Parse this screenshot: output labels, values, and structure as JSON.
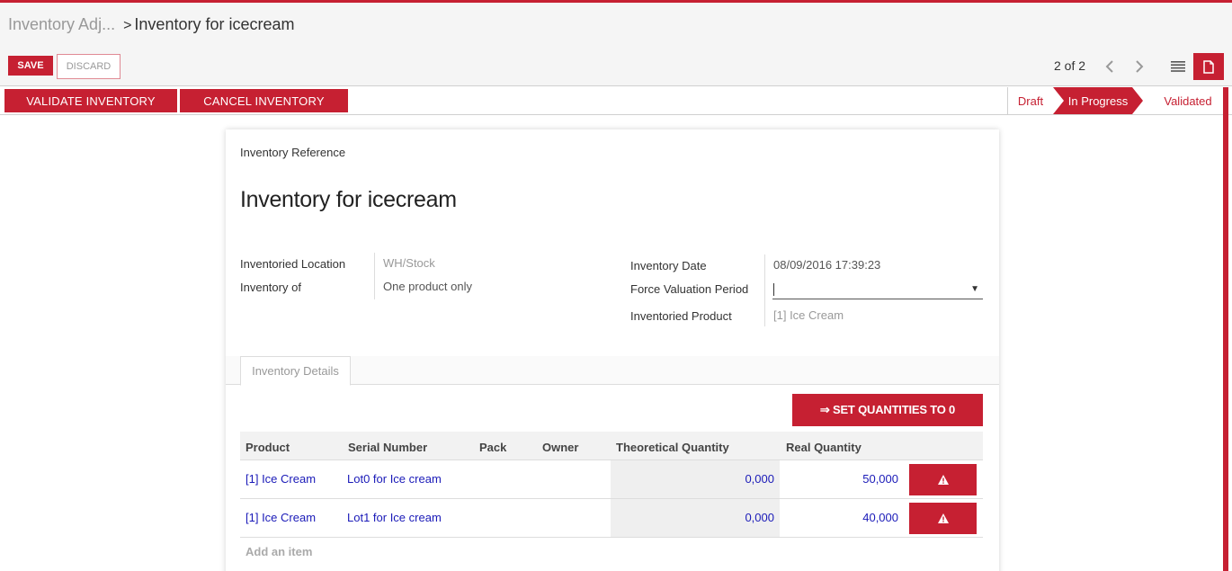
{
  "breadcrumb": {
    "parent": "Inventory Adj...",
    "separator": ">",
    "current": "Inventory for icecream"
  },
  "toolbar": {
    "save_label": "SAVE",
    "discard_label": "DISCARD"
  },
  "pager": {
    "value": "2 of 2"
  },
  "actions": {
    "validate_label": "VALIDATE INVENTORY",
    "cancel_label": "CANCEL INVENTORY"
  },
  "stages": {
    "draft": "Draft",
    "in_progress": "In Progress",
    "validated": "Validated",
    "active": "In Progress"
  },
  "form": {
    "reference_label": "Inventory Reference",
    "reference_value": "Inventory for icecream",
    "location_label": "Inventoried Location",
    "location_value": "WH/Stock",
    "inventory_of_label": "Inventory of",
    "inventory_of_value": "One product only",
    "date_label": "Inventory Date",
    "date_value": "08/09/2016 17:39:23",
    "period_label": "Force Valuation Period",
    "period_value": "",
    "product_label": "Inventoried Product",
    "product_value": "[1] Ice Cream"
  },
  "tabs": [
    {
      "label": "Inventory Details"
    }
  ],
  "set_quantities_label": "⇒ SET QUANTITIES TO 0",
  "table": {
    "columns": [
      "Product",
      "Serial Number",
      "Pack",
      "Owner",
      "Theoretical Quantity",
      "Real Quantity"
    ],
    "rows": [
      {
        "product": "[1] Ice Cream",
        "serial": "Lot0 for Ice cream",
        "pack": "",
        "owner": "",
        "theoretical": "0,000",
        "real": "50,000"
      },
      {
        "product": "[1] Ice Cream",
        "serial": "Lot1 for Ice cream",
        "pack": "",
        "owner": "",
        "theoretical": "0,000",
        "real": "40,000"
      }
    ],
    "add_item_label": "Add an item"
  },
  "colors": {
    "brand": "#c62032",
    "link": "#1a1ab8"
  },
  "icons": {
    "prev": "chevron-left-icon",
    "next": "chevron-right-icon",
    "list_view": "list-view-icon",
    "form_view": "form-view-icon",
    "row_action": "warning-icon"
  }
}
